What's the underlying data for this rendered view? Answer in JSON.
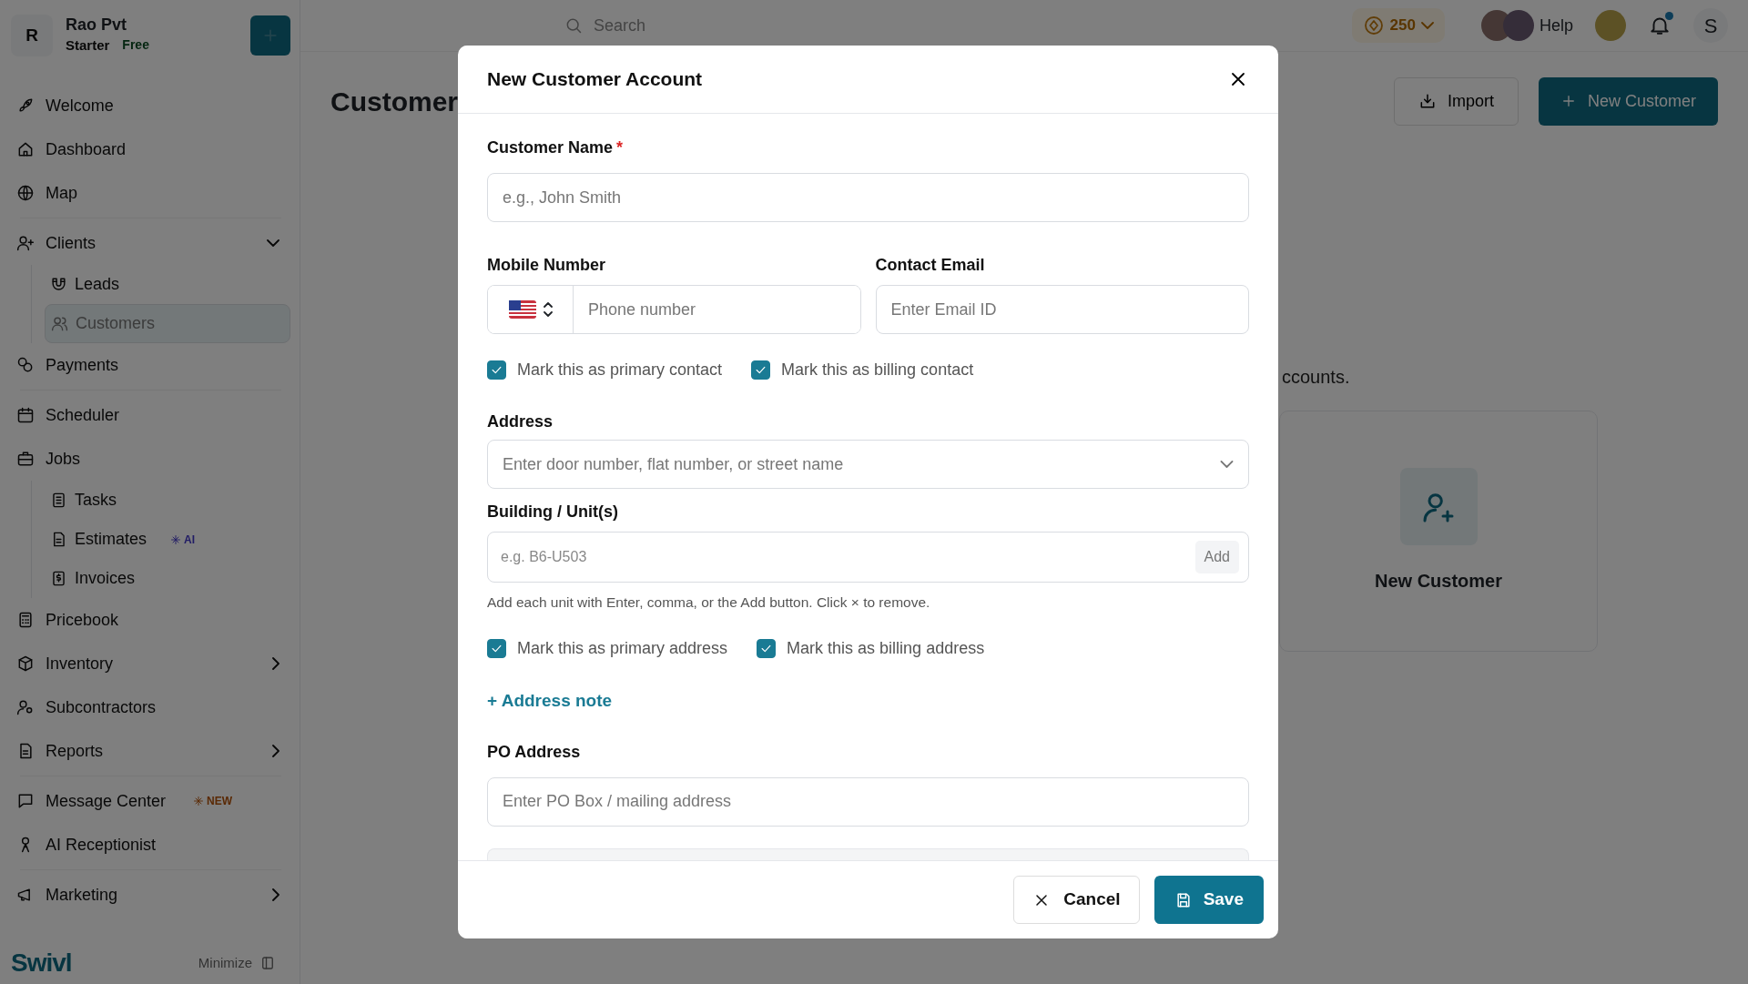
{
  "sidebar": {
    "workspace": {
      "initial": "R",
      "name": "Rao Pvt",
      "plan": "Starter",
      "tier": "Free"
    },
    "groups": [
      [
        {
          "label": "Welcome"
        },
        {
          "label": "Dashboard"
        },
        {
          "label": "Map"
        }
      ],
      [
        {
          "label": "Clients",
          "expanded": true,
          "children": [
            {
              "label": "Leads",
              "selected": false
            },
            {
              "label": "Customers",
              "selected": true
            }
          ]
        },
        {
          "label": "Payments"
        }
      ],
      [
        {
          "label": "Scheduler"
        },
        {
          "label": "Jobs",
          "children": [
            {
              "label": "Tasks",
              "selected": false
            },
            {
              "label": "Estimates",
              "selected": false,
              "badge": {
                "text": "AI",
                "kind": "ai"
              }
            },
            {
              "label": "Invoices",
              "selected": false
            }
          ]
        },
        {
          "label": "Pricebook"
        },
        {
          "label": "Inventory",
          "expanded": false
        },
        {
          "label": "Subcontractors"
        },
        {
          "label": "Reports",
          "expanded": false
        }
      ],
      [
        {
          "label": "Message Center",
          "badge": {
            "text": "NEW",
            "kind": "new"
          }
        },
        {
          "label": "AI Receptionist"
        }
      ],
      [
        {
          "label": "Marketing",
          "expanded": false
        }
      ]
    ],
    "footer": {
      "logo": "Swivl",
      "minimize": "Minimize"
    }
  },
  "topbar": {
    "search_placeholder": "Search",
    "credits": "250",
    "help": "Help",
    "user_initial": "S"
  },
  "page": {
    "title": "Customer",
    "import": "Import",
    "new_customer": "New Customer",
    "subtitle": "ccounts.",
    "card_label": "New Customer"
  },
  "modal": {
    "title": "New Customer Account",
    "customer_name": {
      "label": "Customer Name",
      "required_mark": "*",
      "placeholder": "e.g., John Smith"
    },
    "mobile": {
      "label": "Mobile Number",
      "placeholder": "Phone number"
    },
    "email": {
      "label": "Contact Email",
      "placeholder": "Enter Email ID"
    },
    "contact_checks": [
      {
        "label": "Mark this as primary contact",
        "checked": true
      },
      {
        "label": "Mark this as billing contact",
        "checked": true
      }
    ],
    "address": {
      "label": "Address",
      "placeholder": "Enter door number, flat number, or street name"
    },
    "building": {
      "label": "Building / Unit(s)",
      "placeholder": "e.g. B6-U503",
      "add": "Add",
      "hint": "Add each unit with Enter, comma, or the Add button. Click × to remove."
    },
    "address_checks": [
      {
        "label": "Mark this as primary address",
        "checked": true
      },
      {
        "label": "Mark this as billing address",
        "checked": true
      }
    ],
    "address_note": "+ Address note",
    "po_address": {
      "label": "PO Address",
      "placeholder": "Enter PO Box / mailing address"
    },
    "cancel": "Cancel",
    "save": "Save"
  }
}
